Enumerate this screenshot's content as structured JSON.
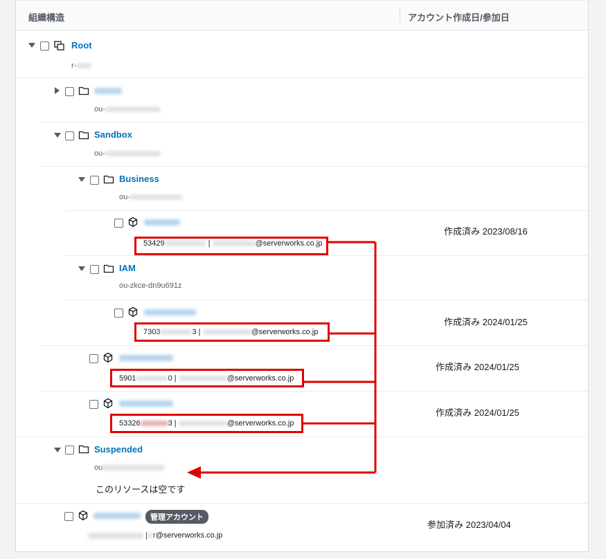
{
  "header": {
    "col_structure": "組織構造",
    "col_date": "アカウント作成日/参加日"
  },
  "tree": {
    "root": {
      "label": "Root",
      "id": "r-"
    },
    "ou1": {
      "id": "ou-"
    },
    "sandbox": {
      "label": "Sandbox",
      "id": "ou-"
    },
    "business": {
      "label": "Business",
      "id": "ou-"
    },
    "acct_business": {
      "id_prefix": "53429",
      "email_domain": "@serverworks.co.jp",
      "date": "作成済み 2023/08/16"
    },
    "iam": {
      "label": "IAM",
      "id": "ou-zkce-dn9u691z"
    },
    "acct_iam": {
      "id_prefix": "7303",
      "id_suffix": "3",
      "email_domain": "@serverworks.co.jp",
      "date": "作成済み 2024/01/25"
    },
    "acct_sb1": {
      "id_prefix": "5901",
      "id_suffix": "0",
      "email_domain": "@serverworks.co.jp",
      "date": "作成済み 2024/01/25"
    },
    "acct_sb2": {
      "id_prefix": "53326",
      "id_suffix": "3",
      "email_domain": "@serverworks.co.jp",
      "date": "作成済み 2024/01/25"
    },
    "suspended": {
      "label": "Suspended",
      "id": "ou",
      "empty_text": "このリソースは空です"
    },
    "mgmt": {
      "badge": "管理アカウント",
      "email": "r@serverworks.co.jp",
      "date": "参加済み 2023/04/04"
    }
  },
  "separator": "|",
  "colors": {
    "link": "#0073bb",
    "annotation": "#e00000"
  }
}
